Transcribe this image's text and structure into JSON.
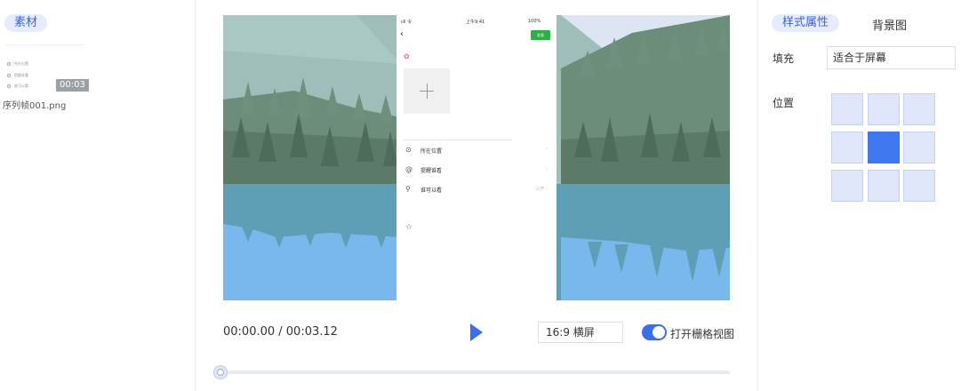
{
  "left_panel": {
    "tab_label": "素材",
    "material": {
      "mini_rows": [
        "所在位置",
        "提醒谁看",
        "谁可以看"
      ],
      "duration": "00:03",
      "file_name": "序列帧001.png"
    }
  },
  "phone": {
    "status_left": "ııll 令",
    "status_time": "上午9:41",
    "status_battery": "100%",
    "publish_label": "发表",
    "menu_items": [
      {
        "icon": "location-icon",
        "glyph": "⊙",
        "label": "所在位置",
        "right": "›"
      },
      {
        "icon": "at-icon",
        "glyph": "@",
        "label": "提醒谁看",
        "right": "›"
      },
      {
        "icon": "person-icon",
        "glyph": "⚲",
        "label": "谁可以看",
        "right": "公开 ›"
      }
    ]
  },
  "player": {
    "time_display": "00:00.00 / 00:03.12",
    "aspect_ratio": "16:9 横屏",
    "grid_toggle_label": "打开栅格视图",
    "grid_toggle_on": true,
    "progress": 0
  },
  "right_panel": {
    "tabs": [
      "样式属性",
      "背景图"
    ],
    "active_tab": "样式属性",
    "fill_label": "填充",
    "fill_value": "适合于屏幕",
    "position_label": "位置",
    "position_selected": "middle-center"
  },
  "colors": {
    "accent": "#3a6ef0",
    "publish_green": "#2bb046",
    "sky": "#a3c1bd",
    "forest": "#5c7a68",
    "lake": "#5e9fb5",
    "water_light": "#76b6ec"
  }
}
